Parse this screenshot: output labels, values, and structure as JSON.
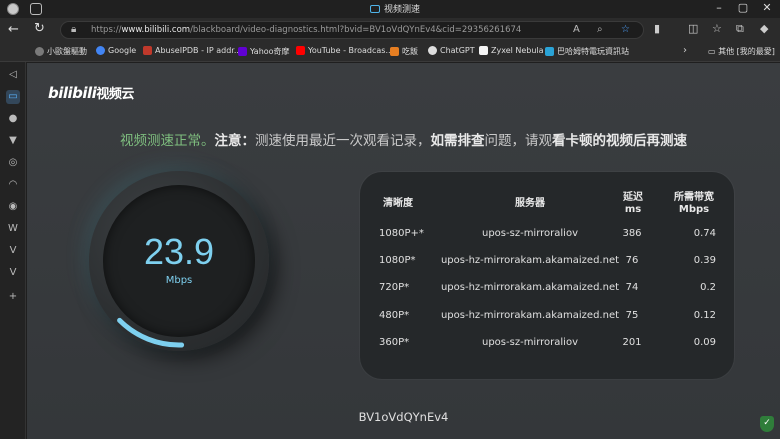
{
  "browser": {
    "tab_title": "视频测速",
    "url_prefix": "https://",
    "url_domain": "www.bilibili.com",
    "url_path": "/blackboard/video-diagnostics.html?bvid=BV1oVdQYnEv4&cid=29356261674",
    "icons": [
      "profile-avatar-icon",
      "tab-actions-icon",
      "back-arrow-icon",
      "reload-icon",
      "lock-icon",
      "read-aloud-icon",
      "zoom-icon",
      "favorite-star-icon",
      "extension-icon",
      "favorites-icon",
      "copilot-icon"
    ]
  },
  "bookmarks": {
    "items": [
      {
        "label": "小歐盤驅動",
        "color": "#7a7a7a"
      },
      {
        "label": "Google",
        "color": "#4285f4"
      },
      {
        "label": "AbuseIPDB - IP addr...",
        "color": "#c0392b"
      },
      {
        "label": "Yahoo奇摩",
        "color": "#6001d2"
      },
      {
        "label": "YouTube - Broadcas...",
        "color": "#ff0000"
      },
      {
        "label": "吃飯",
        "color": "#e67e22"
      },
      {
        "label": "ChatGPT",
        "color": "#dddddd"
      },
      {
        "label": "Zyxel Nebula",
        "color": "#f5f5f5"
      },
      {
        "label": "巴哈姆特電玩資訊站",
        "color": "#2aa3d6"
      }
    ],
    "other": "其他 [我的最愛]"
  },
  "page": {
    "logo_main": "bilibili",
    "logo_sub": "视频云",
    "notice_ok": "视频测速正常。",
    "notice_text_1": "注意：",
    "notice_text_2": "测速使用最近一次观看记录，",
    "notice_text_3": "如需排查",
    "notice_text_4": "问题，请观",
    "notice_text_5": "看卡顿的视频后再测速",
    "speed_value": "23.9",
    "speed_unit": "Mbps",
    "speed_progress": 0.13,
    "accent": "#7ed0ef",
    "bvid": "BV1oVdQYnEv4"
  },
  "table": {
    "headers": {
      "resolution": "清晰度",
      "server": "服务器",
      "latency_1": "延迟",
      "latency_2": "ms",
      "bandwidth_1": "所需带宽",
      "bandwidth_2": "Mbps"
    },
    "rows": [
      {
        "res": "1080P+*",
        "server": "upos-sz-mirroraliov",
        "latency": "386",
        "bw": "0.74"
      },
      {
        "res": "1080P*",
        "server": "upos-hz-mirrorakam.akamaized.net",
        "latency": "76",
        "bw": "0.39"
      },
      {
        "res": "720P*",
        "server": "upos-hz-mirrorakam.akamaized.net",
        "latency": "74",
        "bw": "0.2"
      },
      {
        "res": "480P*",
        "server": "upos-hz-mirrorakam.akamaized.net",
        "latency": "75",
        "bw": "0.12"
      },
      {
        "res": "360P*",
        "server": "upos-sz-mirroraliov",
        "latency": "201",
        "bw": "0.09"
      }
    ]
  }
}
